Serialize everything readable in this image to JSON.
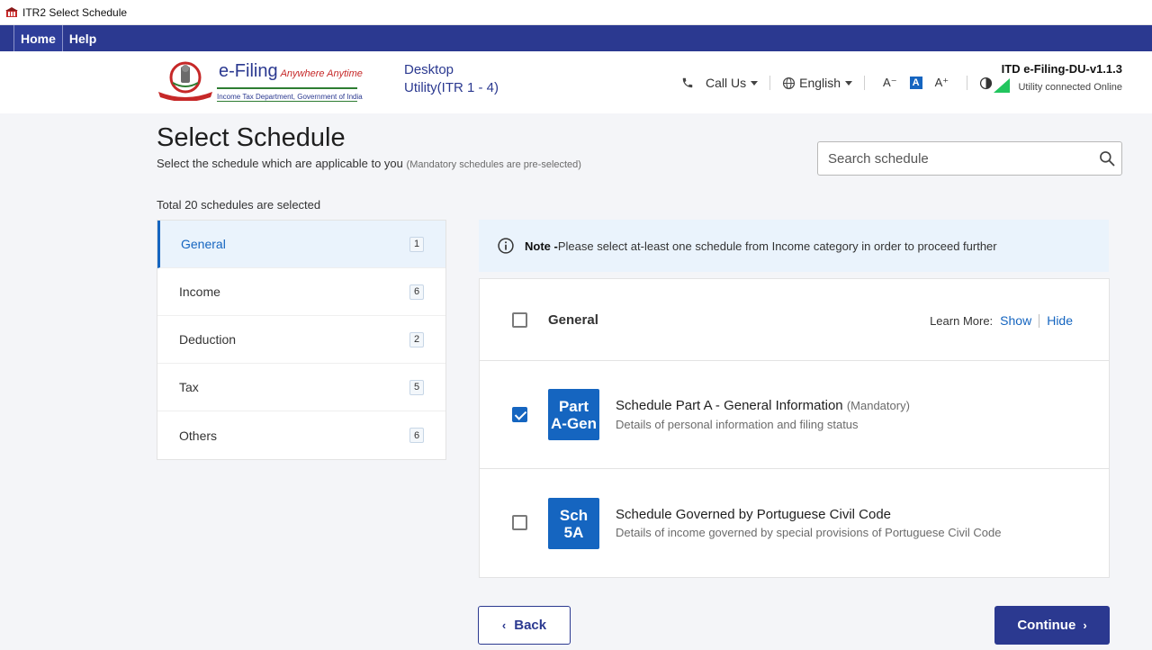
{
  "window": {
    "title": "ITR2 Select Schedule"
  },
  "menu": {
    "items": [
      "Home",
      "Help"
    ]
  },
  "header": {
    "logo": {
      "brand": "e-Filing",
      "tagline": "Anywhere Anytime",
      "dept": "Income Tax Department, Government of India"
    },
    "du_title_line1": "Desktop",
    "du_title_line2": "Utility(ITR 1 - 4)",
    "call_us": "Call Us",
    "language": "English",
    "font_decrease": "A⁻",
    "font_normal": "A",
    "font_increase": "A⁺",
    "version": "ITD e-Filing-DU-v1.1.3",
    "status": "Utility connected Online"
  },
  "page": {
    "title": "Select Schedule",
    "subtitle": "Select the schedule which are applicable to you",
    "subtitle_note": "(Mandatory schedules are pre-selected)",
    "search_placeholder": "Search schedule",
    "total_selected": "Total 20 schedules are selected"
  },
  "categories": [
    {
      "label": "General",
      "count": "1",
      "active": true
    },
    {
      "label": "Income",
      "count": "6",
      "active": false
    },
    {
      "label": "Deduction",
      "count": "2",
      "active": false
    },
    {
      "label": "Tax",
      "count": "5",
      "active": false
    },
    {
      "label": "Others",
      "count": "6",
      "active": false
    }
  ],
  "note": {
    "bold": "Note -",
    "text": "Please select at-least one schedule from Income category in order to proceed further"
  },
  "panel": {
    "group_label": "General",
    "learn_more": "Learn More:",
    "show": "Show",
    "hide": "Hide",
    "schedules": [
      {
        "badge_line1": "Part",
        "badge_line2": "A-Gen",
        "title": "Schedule Part A - General Information",
        "mandatory": "(Mandatory)",
        "desc": "Details of personal information and filing status",
        "checked": true
      },
      {
        "badge_line1": "Sch",
        "badge_line2": "5A",
        "title": "Schedule Governed by Portuguese Civil Code",
        "mandatory": "",
        "desc": "Details of income governed by special provisions of Portuguese Civil Code",
        "checked": false
      }
    ]
  },
  "buttons": {
    "back": "Back",
    "continue": "Continue"
  },
  "colors": {
    "primary": "#2b3990",
    "accent": "#1565c0",
    "online": "#22c55e"
  }
}
